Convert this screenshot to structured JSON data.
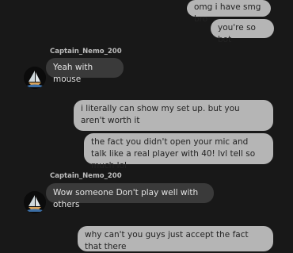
{
  "messages": [
    {
      "side": "out",
      "text": "omg i have smg bro"
    },
    {
      "side": "out",
      "text": "you're so bot"
    },
    {
      "side": "in",
      "author": "Captain_Nemo_200",
      "avatar_icon": "sailboat-icon",
      "text": "Yeah with mouse"
    },
    {
      "side": "out",
      "text": "i literally can show my set up. but you aren't worth it"
    },
    {
      "side": "out",
      "text": "the fact you didn't open your mic and talk like a real player with 40! lvl tell so much lol"
    },
    {
      "side": "in",
      "author": "Captain_Nemo_200",
      "avatar_icon": "sailboat-icon",
      "text": "Wow someone Don't play well with others"
    },
    {
      "side": "out",
      "text": "why can't you guys just accept the fact that there"
    }
  ],
  "colors": {
    "background": "#181818",
    "outgoing_bubble": "#b5b5b5",
    "incoming_bubble": "#3a3a3a"
  }
}
